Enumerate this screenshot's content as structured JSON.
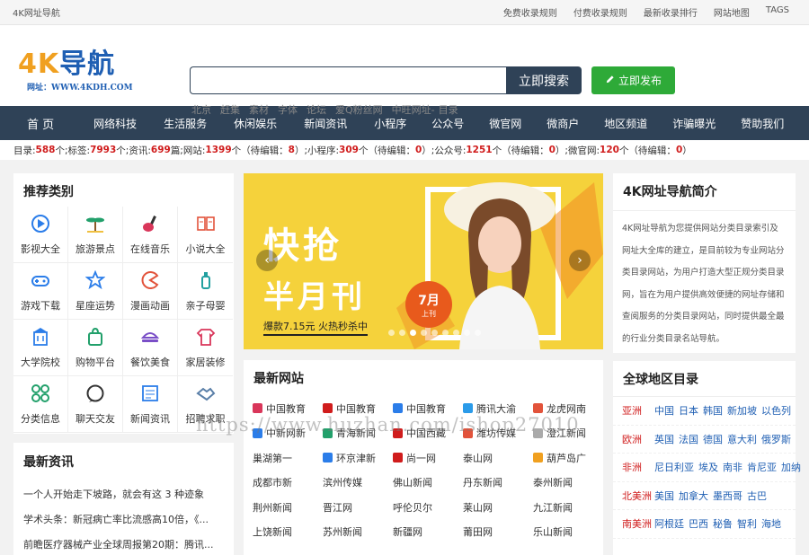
{
  "topbar": {
    "site_name": "4K网址导航",
    "links": [
      "免费收录规则",
      "付费收录规则",
      "最新收录排行",
      "网站地图",
      "TAGS"
    ]
  },
  "logo": {
    "main": "4K导航",
    "sub": "网址：WWW.4KDH.COM"
  },
  "search": {
    "placeholder": "",
    "button_label": "立即搜索"
  },
  "publish": {
    "label": "立即发布",
    "icon": "pencil-icon"
  },
  "hot_words": [
    "北京",
    "赶集",
    "素材",
    "字体",
    "论坛",
    "爱Q粉丝网",
    "中旺网址-",
    "目录"
  ],
  "nav": {
    "home": "首 页",
    "items": [
      "网络科技",
      "生活服务",
      "休闲娱乐",
      "新闻资讯",
      "小程序",
      "公众号",
      "微官网",
      "微商户",
      "地区频道",
      "诈骗曝光",
      "赞助我们"
    ]
  },
  "stats": [
    {
      "label": "目录:",
      "value": "588",
      "suffix": "个; "
    },
    {
      "label": "标签:",
      "value": "7993",
      "suffix": "个; "
    },
    {
      "label": "资讯:",
      "value": "699",
      "suffix": "篇; "
    },
    {
      "label": "网站:",
      "value": "1399",
      "suffix": "个（待编辑：",
      "pending": "8",
      "end": "）; "
    },
    {
      "label": "小程序:",
      "value": "309",
      "suffix": "个（待编辑：",
      "pending": "0",
      "end": "）; "
    },
    {
      "label": "公众号:",
      "value": "1251",
      "suffix": "个（待编辑：",
      "pending": "0",
      "end": "）; "
    },
    {
      "label": "微官网:",
      "value": "120",
      "suffix": "个（待编辑：",
      "pending": "0",
      "end": "）"
    }
  ],
  "categories": {
    "title": "推荐类别",
    "items": [
      {
        "label": "影视大全",
        "icon": "play-icon",
        "color": "#2b7de9"
      },
      {
        "label": "旅游景点",
        "icon": "palm-tree-icon",
        "color": "#22a06b"
      },
      {
        "label": "在线音乐",
        "icon": "guitar-icon",
        "color": "#d9365a"
      },
      {
        "label": "小说大全",
        "icon": "book-icon",
        "color": "#e2533b"
      },
      {
        "label": "游戏下载",
        "icon": "gamepad-icon",
        "color": "#2b7de9"
      },
      {
        "label": "星座运势",
        "icon": "star-icon",
        "color": "#2b7de9"
      },
      {
        "label": "漫画动画",
        "icon": "pacman-icon",
        "color": "#e2533b"
      },
      {
        "label": "亲子母婴",
        "icon": "baby-bottle-icon",
        "color": "#22a0a0"
      },
      {
        "label": "大学院校",
        "icon": "building-icon",
        "color": "#2b7de9"
      },
      {
        "label": "购物平台",
        "icon": "shopping-bag-icon",
        "color": "#22a06b"
      },
      {
        "label": "餐饮美食",
        "icon": "food-icon",
        "color": "#7a4fc7"
      },
      {
        "label": "家居装修",
        "icon": "shirt-icon",
        "color": "#d9365a"
      },
      {
        "label": "分类信息",
        "icon": "grid-icon",
        "color": "#22a06b"
      },
      {
        "label": "聊天交友",
        "icon": "chat-icon",
        "color": "#333333"
      },
      {
        "label": "新闻资讯",
        "icon": "newspaper-icon",
        "color": "#2b7de9"
      },
      {
        "label": "招聘求职",
        "icon": "handshake-icon",
        "color": "#5a7fa8"
      }
    ]
  },
  "news": {
    "title": "最新资讯",
    "items": [
      "一个人开始走下坡路，就会有这 3 种迹象",
      "学术头条：新冠病亡率比流感高10倍，《...",
      "前瞻医疗器械产业全球周报第20期：腾讯..."
    ]
  },
  "banner": {
    "headline_1": "快抢",
    "headline_2": "半月刊",
    "sub": "爆款7.15元 火热秒杀中",
    "badge_main": "7月",
    "badge_sub": "上刊"
  },
  "latest_sites": {
    "title": "最新网站",
    "rows": [
      [
        {
          "name": "中国教育",
          "color": "#d9365a"
        },
        {
          "name": "中国教育",
          "color": "#d01c1c"
        },
        {
          "name": "中国教育",
          "color": "#2b7de9"
        },
        {
          "name": "腾讯大渝",
          "color": "#2b9be9"
        },
        {
          "name": "龙虎网南",
          "color": "#e2533b"
        }
      ],
      [
        {
          "name": "中新网新",
          "color": "#2b7de9"
        },
        {
          "name": "青海新闻",
          "color": "#22a06b"
        },
        {
          "name": "中国西藏",
          "color": "#d01c1c"
        },
        {
          "name": "潍坊传媒",
          "color": "#e2533b"
        },
        {
          "name": "澄江新闻",
          "color": "#aaaaaa"
        }
      ],
      [
        {
          "name": "巢湖第一",
          "color": ""
        },
        {
          "name": "环京津新",
          "color": "#2b7de9"
        },
        {
          "name": "尚一网",
          "color": "#d01c1c"
        },
        {
          "name": "泰山网",
          "color": ""
        },
        {
          "name": "葫芦岛广",
          "color": "#f0a020"
        }
      ],
      [
        {
          "name": "成都市新",
          "color": ""
        },
        {
          "name": "滨州传媒",
          "color": ""
        },
        {
          "name": "佛山新闻",
          "color": ""
        },
        {
          "name": "丹东新闻",
          "color": ""
        },
        {
          "name": "泰州新闻",
          "color": ""
        }
      ],
      [
        {
          "name": "荆州新闻",
          "color": ""
        },
        {
          "name": "晋江网",
          "color": ""
        },
        {
          "name": "呼伦贝尔",
          "color": ""
        },
        {
          "name": "莱山网",
          "color": ""
        },
        {
          "name": "九江新闻",
          "color": ""
        }
      ],
      [
        {
          "name": "上饶新闻",
          "color": ""
        },
        {
          "name": "苏州新闻",
          "color": ""
        },
        {
          "name": "新疆网",
          "color": ""
        },
        {
          "name": "莆田网",
          "color": ""
        },
        {
          "name": "乐山新闻",
          "color": ""
        }
      ]
    ]
  },
  "intro": {
    "title": "4K网址导航简介",
    "text": "4K网址导航为您提供网站分类目录索引及网址大全库的建立，是目前较为专业网站分类目录网站，为用户打造大型正规分类目录网，旨在为用户提供高效便捷的网址存储和查阅服务的分类目录网站，同时提供最全最的行业分类目录名站导航。"
  },
  "regions": {
    "title": "全球地区目录",
    "rows": [
      {
        "name": "亚洲",
        "items": [
          "中国",
          "日本",
          "韩国",
          "新加坡",
          "以色列"
        ]
      },
      {
        "name": "欧洲",
        "items": [
          "英国",
          "法国",
          "德国",
          "意大利",
          "俄罗斯"
        ]
      },
      {
        "name": "非洲",
        "items": [
          "尼日利亚",
          "埃及",
          "南非",
          "肯尼亚",
          "加纳"
        ]
      },
      {
        "name": "北美洲",
        "items": [
          "美国",
          "加拿大",
          "墨西哥",
          "古巴"
        ]
      },
      {
        "name": "南美洲",
        "items": [
          "阿根廷",
          "巴西",
          "秘鲁",
          "智利",
          "海地"
        ]
      }
    ]
  },
  "watermark": "https://www.huzhan.com/ishop27010"
}
